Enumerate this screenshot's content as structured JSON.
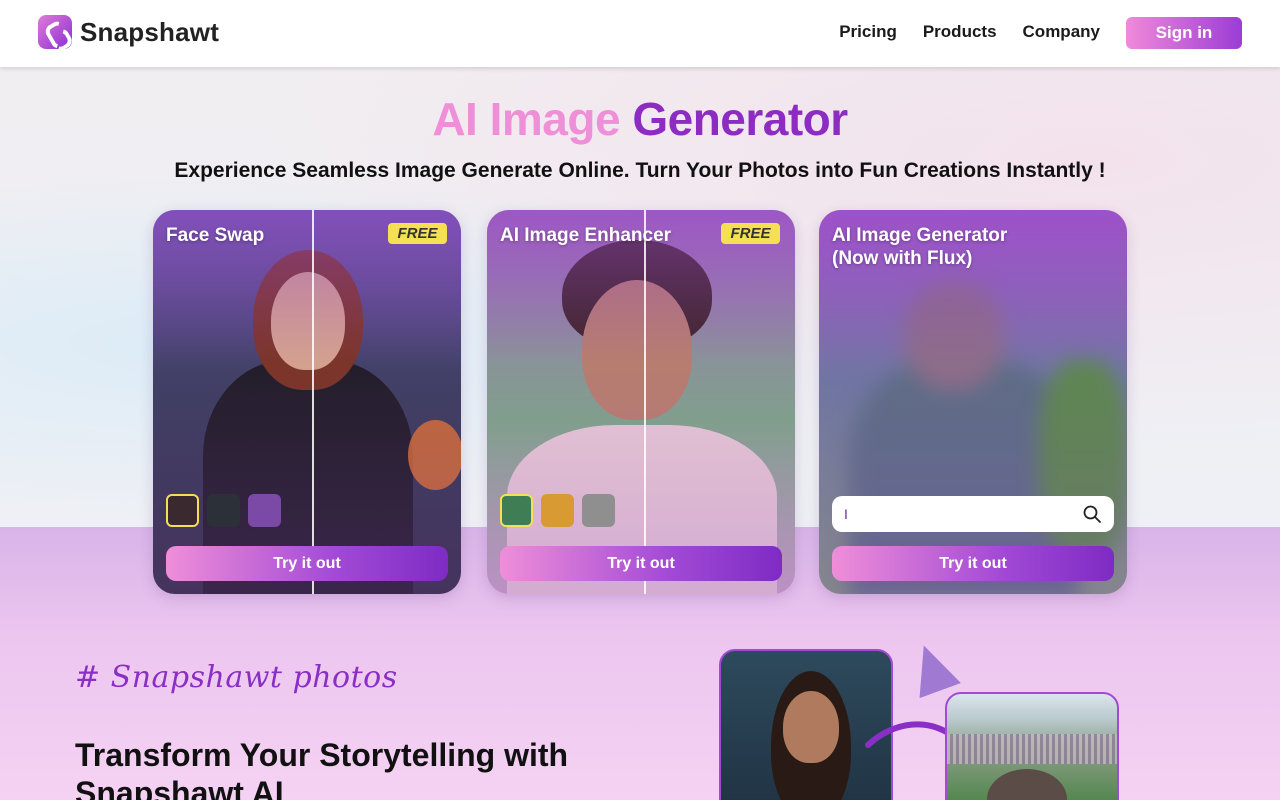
{
  "header": {
    "brand": "Snapshawt",
    "nav": [
      "Pricing",
      "Products",
      "Company"
    ],
    "signin_label": "Sign in"
  },
  "hero": {
    "title_part1": "AI Image",
    "title_part2": "Generator",
    "subtitle": "Experience Seamless Image Generate Online. Turn Your Photos into Fun Creations Instantly !"
  },
  "cards": [
    {
      "title": "Face Swap",
      "badge": "FREE",
      "button": "Try it out",
      "thumb_count": 3
    },
    {
      "title": "AI Image Enhancer",
      "badge": "FREE",
      "button": "Try it out",
      "thumb_count": 3
    },
    {
      "title_line1": "AI Image Generator",
      "title_line2": "(Now with Flux)",
      "search_value": "I",
      "button": "Try it out"
    }
  ],
  "lower": {
    "hashtag": "# Snapshawt photos",
    "heading": "Transform Your Storytelling with Snapshawt AI"
  },
  "colors": {
    "accent_pink": "#ee8fd7",
    "accent_purple": "#8d2cc2",
    "badge_yellow": "#f5df53"
  },
  "icons": {
    "search": "search-icon",
    "logo": "snapshawt-logo-icon"
  }
}
